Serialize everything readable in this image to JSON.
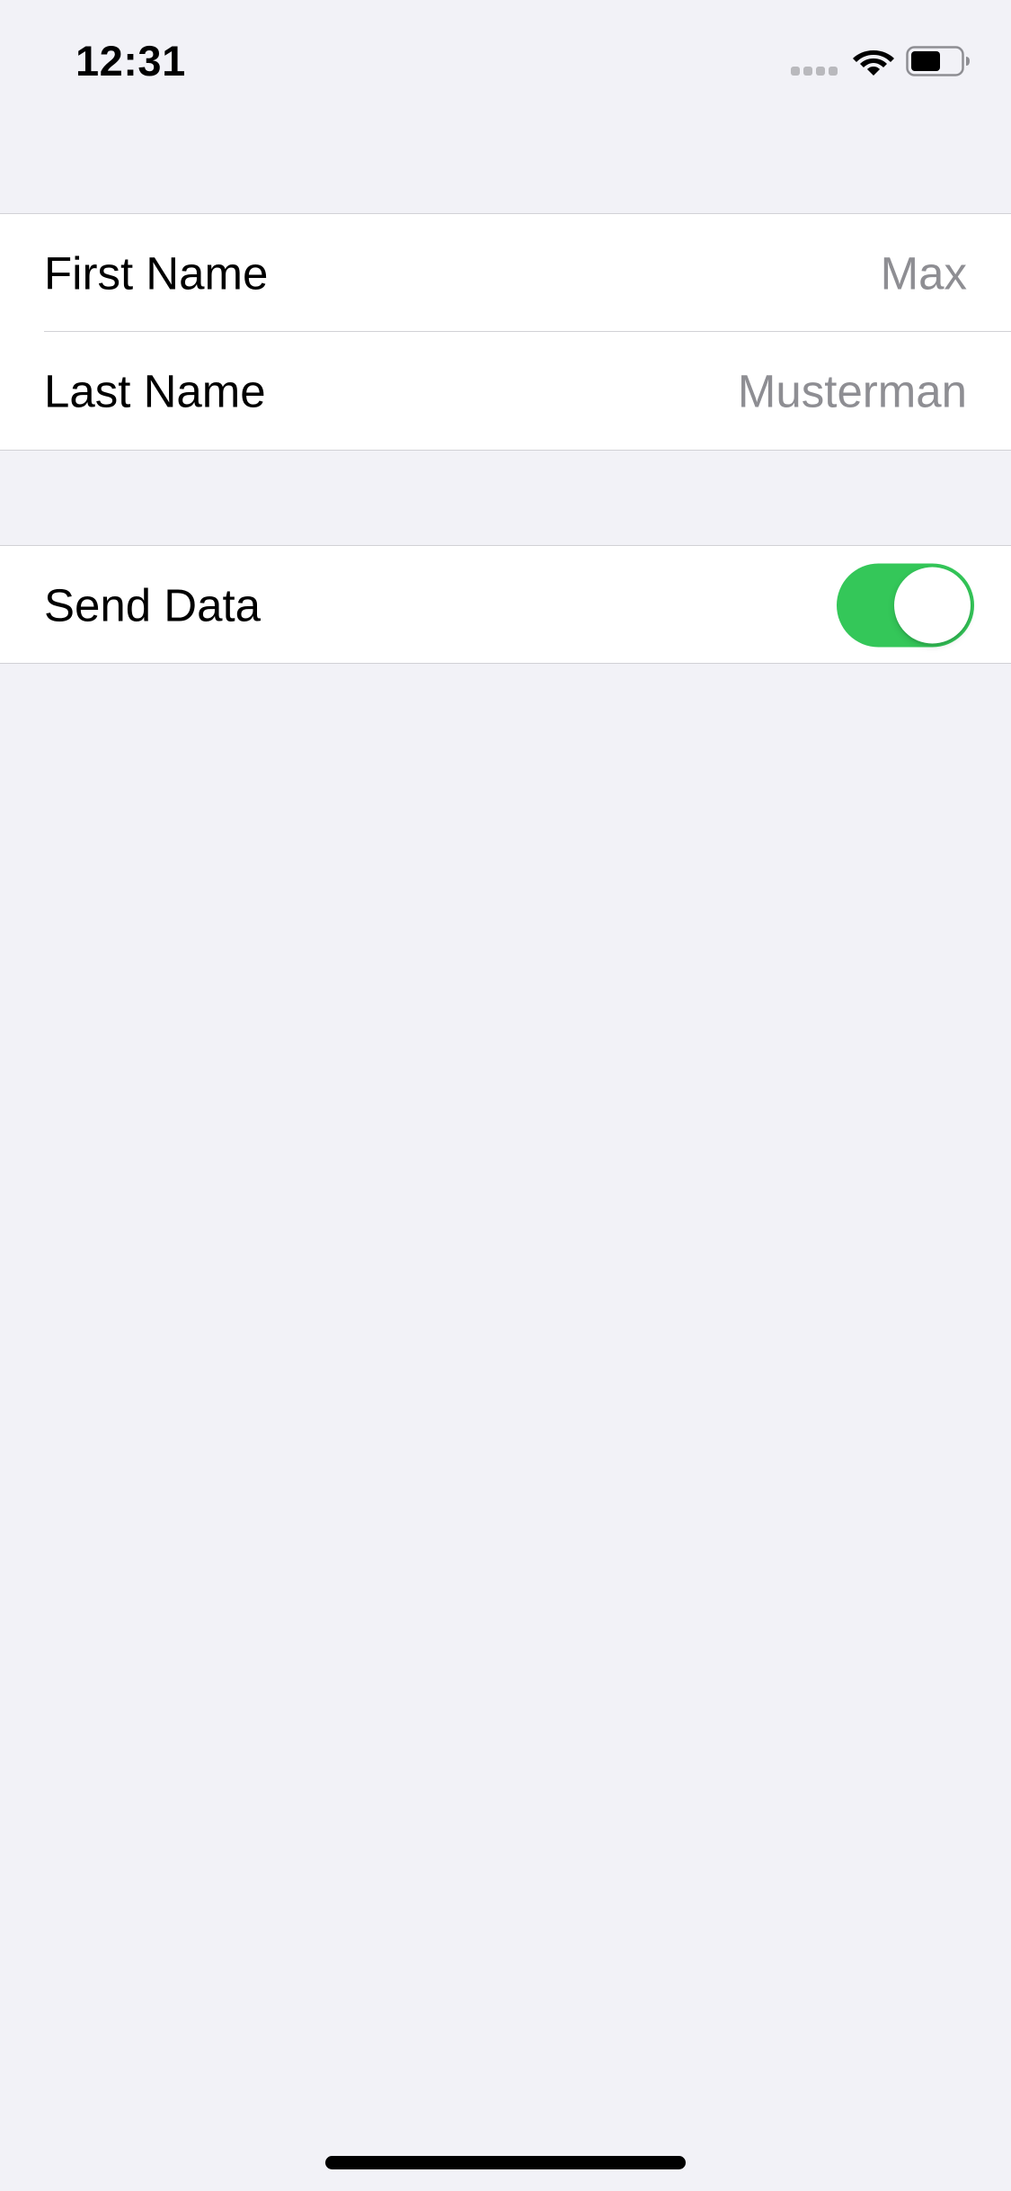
{
  "status_bar": {
    "time": "12:31",
    "icons": [
      "cellular-signal-icon",
      "wifi-icon",
      "battery-icon"
    ]
  },
  "form": {
    "first_name": {
      "label": "First Name",
      "value": "",
      "placeholder": "Max"
    },
    "last_name": {
      "label": "Last Name",
      "value": "",
      "placeholder": "Musterman"
    },
    "send_data": {
      "label": "Send Data",
      "on": true
    }
  },
  "colors": {
    "background": "#f2f2f7",
    "cell": "#ffffff",
    "separator": "#d1d1d6",
    "toggle_on": "#34c759",
    "placeholder": "#8e8e93"
  }
}
